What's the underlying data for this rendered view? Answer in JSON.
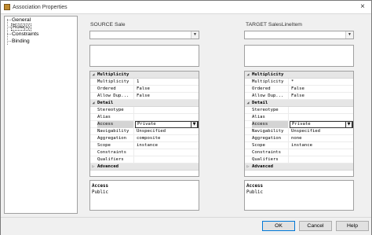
{
  "window": {
    "title": "Association Properties",
    "close_glyph": "×"
  },
  "tree": {
    "items": [
      {
        "label": "General",
        "selected": false
      },
      {
        "label": "Role(s)",
        "selected": true
      },
      {
        "label": "Constraints",
        "selected": false
      },
      {
        "label": "Binding",
        "selected": false
      }
    ]
  },
  "source": {
    "label": "SOURCE   Sale",
    "combo_value": "",
    "grid": [
      {
        "kind": "category",
        "toggle": "◢",
        "name": "Multiplicity"
      },
      {
        "kind": "prop",
        "name": "Multiplicity",
        "value": "1"
      },
      {
        "kind": "prop",
        "name": "Ordered",
        "value": "False"
      },
      {
        "kind": "prop",
        "name": "Allow Dup...",
        "value": "False"
      },
      {
        "kind": "category",
        "toggle": "◢",
        "name": "Detail"
      },
      {
        "kind": "prop",
        "name": "Stereotype",
        "value": ""
      },
      {
        "kind": "prop",
        "name": "Alias",
        "value": ""
      },
      {
        "kind": "prop",
        "name": "Access",
        "value": "Private",
        "active": true
      },
      {
        "kind": "prop",
        "name": "Navigability",
        "value": "Unspecified"
      },
      {
        "kind": "prop",
        "name": "Aggregation",
        "value": "composite"
      },
      {
        "kind": "prop",
        "name": "Scope",
        "value": "instance"
      },
      {
        "kind": "prop",
        "name": "Constraints",
        "value": ""
      },
      {
        "kind": "prop",
        "name": "Qualifiers",
        "value": ""
      },
      {
        "kind": "category",
        "toggle": "▷",
        "name": "Advanced"
      }
    ],
    "desc_title": "Access",
    "desc_text": "Public"
  },
  "target": {
    "label": "TARGET   SalesLineItem",
    "combo_value": "",
    "grid": [
      {
        "kind": "category",
        "toggle": "◢",
        "name": "Multiplicity"
      },
      {
        "kind": "prop",
        "name": "Multiplicity",
        "value": "*"
      },
      {
        "kind": "prop",
        "name": "Ordered",
        "value": "False"
      },
      {
        "kind": "prop",
        "name": "Allow Dup...",
        "value": "False"
      },
      {
        "kind": "category",
        "toggle": "◢",
        "name": "Detail"
      },
      {
        "kind": "prop",
        "name": "Stereotype",
        "value": ""
      },
      {
        "kind": "prop",
        "name": "Alias",
        "value": ""
      },
      {
        "kind": "prop",
        "name": "Access",
        "value": "Private",
        "active": true
      },
      {
        "kind": "prop",
        "name": "Navigability",
        "value": "Unspecified"
      },
      {
        "kind": "prop",
        "name": "Aggregation",
        "value": "none"
      },
      {
        "kind": "prop",
        "name": "Scope",
        "value": "instance"
      },
      {
        "kind": "prop",
        "name": "Constraints",
        "value": ""
      },
      {
        "kind": "prop",
        "name": "Qualifiers",
        "value": ""
      },
      {
        "kind": "category",
        "toggle": "▷",
        "name": "Advanced"
      }
    ],
    "desc_title": "Access",
    "desc_text": "Public"
  },
  "buttons": {
    "ok": "OK",
    "cancel": "Cancel",
    "help": "Help"
  },
  "icons": {
    "dropdown": "▼"
  },
  "colors": {
    "focus_border": "#0078d7",
    "category_bg": "#e6e6e6"
  }
}
